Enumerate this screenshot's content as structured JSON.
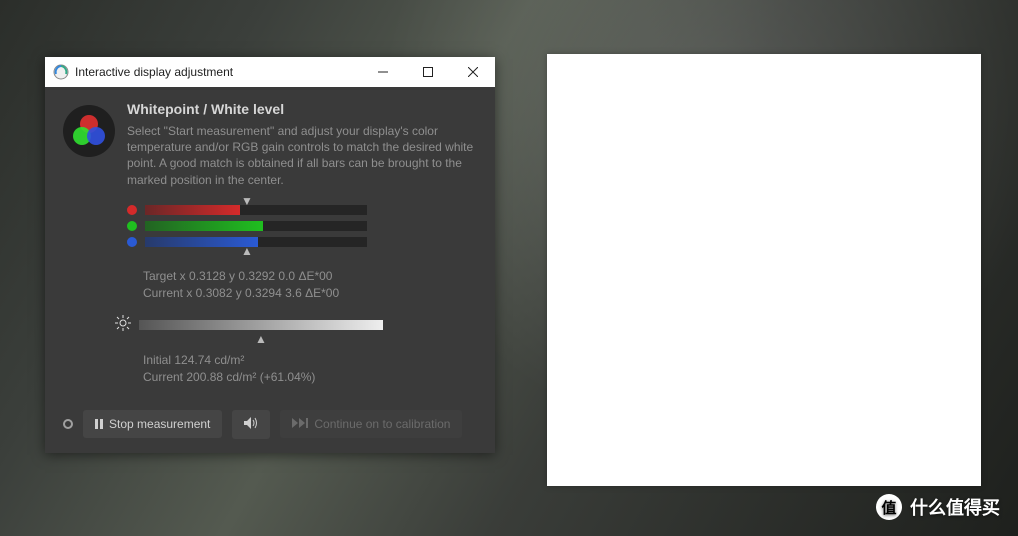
{
  "window": {
    "title": "Interactive display adjustment"
  },
  "panel": {
    "heading": "Whitepoint / White level",
    "description": "Select \"Start measurement\" and adjust your display's color temperature and/or RGB gain controls to match the desired white point. A good match is obtained if all bars can be brought to the marked position in the center."
  },
  "bars": {
    "marker_pct": 50,
    "red": {
      "color": "#d42a2a",
      "fill_pct": 43
    },
    "green": {
      "color": "#1fbf1f",
      "fill_pct": 53
    },
    "blue": {
      "color": "#2a5ad4",
      "fill_pct": 51
    }
  },
  "color_readout": {
    "target_line": "Target x 0.3128 y 0.3292 0.0 ΔE*00",
    "current_line": "Current x 0.3082 y 0.3294 3.6 ΔE*00"
  },
  "brightness": {
    "marker_pct": 50,
    "initial_line": "Initial 124.74 cd/m²",
    "current_line": "Current 200.88 cd/m² (+61.04%)"
  },
  "buttons": {
    "stop_label": "Stop measurement",
    "continue_label": "Continue on to calibration"
  },
  "watermark": {
    "badge": "值",
    "text": "什么值得买"
  }
}
